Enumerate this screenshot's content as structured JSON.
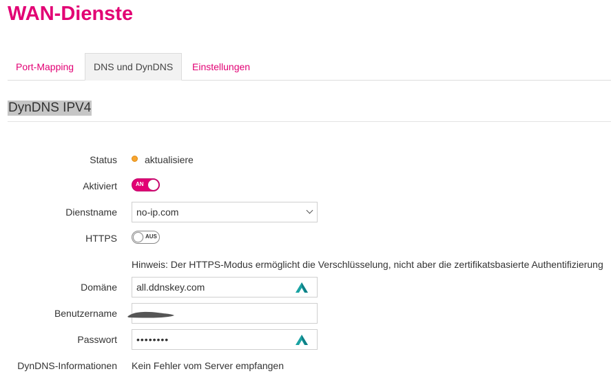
{
  "page": {
    "title": "WAN-Dienste"
  },
  "tabs": [
    {
      "label": "Port-Mapping",
      "active": false
    },
    {
      "label": "DNS und DynDNS",
      "active": true
    },
    {
      "label": "Einstellungen",
      "active": false
    }
  ],
  "section": {
    "title": "DynDNS IPV4"
  },
  "form": {
    "status": {
      "label": "Status",
      "value": "aktualisiere",
      "indicator_color": "#f7a530"
    },
    "activated": {
      "label": "Aktiviert",
      "state": "on",
      "toggle_text": "AN"
    },
    "service": {
      "label": "Dienstname",
      "value": "no-ip.com"
    },
    "https": {
      "label": "HTTPS",
      "state": "off",
      "toggle_text": "AUS"
    },
    "hint": "Hinweis: Der HTTPS-Modus ermöglicht die Verschlüsselung, nicht aber die zertifikatsbasierte Authentifizierung",
    "domain": {
      "label": "Domäne",
      "value": "all.ddnskey.com",
      "icon": "nordpass-icon"
    },
    "username": {
      "label": "Benutzername",
      "value": ""
    },
    "password": {
      "label": "Passwort",
      "value": "••••••••",
      "icon": "nordpass-icon"
    },
    "dyndns_info": {
      "label": "DynDNS-Informationen",
      "value": "Kein Fehler vom Server empfangen"
    }
  },
  "colors": {
    "brand": "#e20074",
    "status_pending": "#f7a530",
    "password_manager_icon": "#1aa3a3"
  }
}
